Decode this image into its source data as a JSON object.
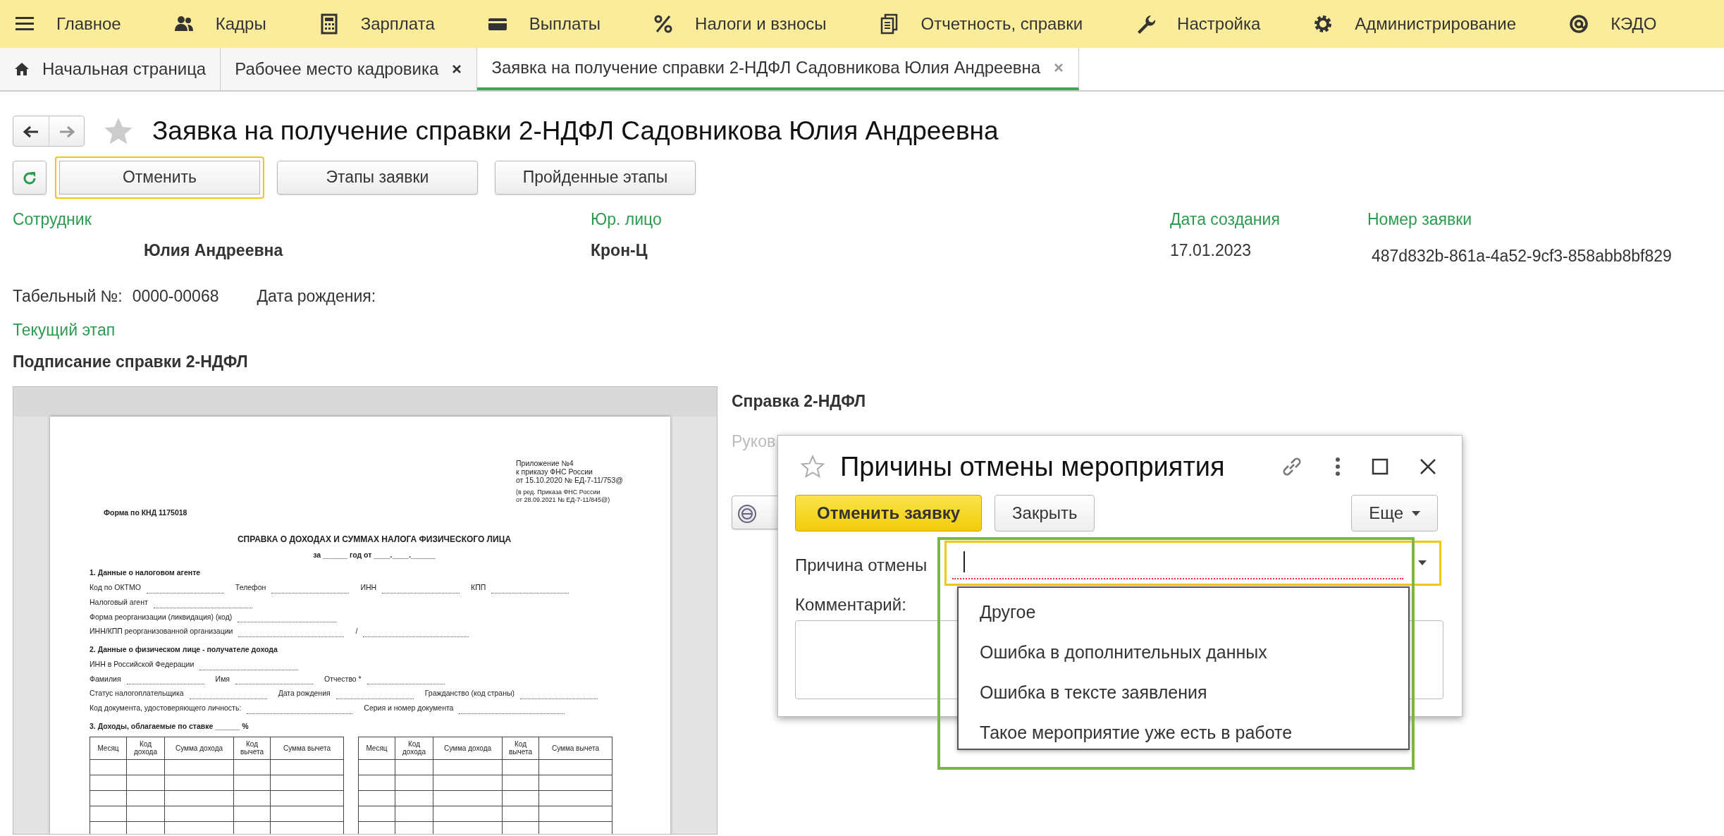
{
  "menu": [
    {
      "label": "Главное"
    },
    {
      "label": "Кадры"
    },
    {
      "label": "Зарплата"
    },
    {
      "label": "Выплаты"
    },
    {
      "label": "Налоги и взносы"
    },
    {
      "label": "Отчетность, справки"
    },
    {
      "label": "Настройка"
    },
    {
      "label": "Администрирование"
    },
    {
      "label": "КЭДО"
    }
  ],
  "tabs": [
    {
      "label": "Начальная страница",
      "selected": false,
      "closable": false,
      "home": true
    },
    {
      "label": "Рабочее место кадровика",
      "selected": false,
      "closable": true,
      "home": false
    },
    {
      "label": "Заявка на получение справки 2-НДФЛ Садовникова Юлия Андреевна",
      "selected": true,
      "closable": true,
      "home": false
    }
  ],
  "form": {
    "title": "Заявка на получение справки 2-НДФЛ Садовникова Юлия Андреевна",
    "favorite": false,
    "buttons": [
      {
        "label": "Отменить",
        "focused": true
      },
      {
        "label": "Этапы заявки",
        "focused": false
      },
      {
        "label": "Пройденные этапы",
        "focused": false
      }
    ],
    "fields": [
      {
        "label": "Сотрудник",
        "value": "Юлия Андреевна"
      },
      {
        "label": "Юр. лицо",
        "value": "Крон-Ц"
      },
      {
        "label": "Дата создания",
        "value": "17.01.2023"
      },
      {
        "label": "Номер заявки",
        "value": "487d832b-861a-4a52-9cf3-858abb8bf829"
      }
    ],
    "personnel_number": {
      "label": "Табельный №:",
      "value": "0000-00068"
    },
    "birth_date": {
      "label": "Дата рождения:"
    },
    "current_stage": {
      "label": "Текущий этап",
      "value": "Подписание справки 2-НДФЛ"
    },
    "side": {
      "title": "Справка 2-НДФЛ",
      "text": "Руков"
    }
  },
  "document": {
    "appendix": [
      "Приложение №4",
      "к приказу ФНС России",
      "от 15.10.2020 № ЕД-7-11/753@"
    ],
    "amendment": [
      "(в ред. Приказа ФНС России",
      "от 28.09.2021 № ЕД-7-11/845@)"
    ],
    "form_code": "Форма по КНД 1175018",
    "heading": "СПРАВКА О ДОХОДАХ И СУММАХ НАЛОГА ФИЗИЧЕСКОГО ЛИЦА",
    "period": "за ______ год от ____.____.______",
    "sections": [
      {
        "title": "1. Данные о налоговом агенте",
        "rows": [
          [
            "Код по ОКТМО",
            "Телефон",
            "ИНН",
            "КПП"
          ],
          [
            "Налоговый агент"
          ],
          [
            "Форма реорганизации (ликвидация) (код)"
          ],
          [
            "ИНН/КПП реорганизованной организации",
            "/"
          ]
        ]
      },
      {
        "title": "2. Данные о физическом лице - получателе дохода",
        "rows": [
          [
            "ИНН в Российской Федерации"
          ],
          [
            "Фамилия",
            "Имя",
            "Отчество *"
          ],
          [
            "Статус налогоплательщика",
            "Дата рождения",
            "Гражданство (код страны)"
          ],
          [
            "Код документа, удостоверяющего личность:",
            "Серия и номер документа"
          ]
        ]
      },
      {
        "title": "3. Доходы, облагаемые по ставке ______ %"
      }
    ],
    "tables": [
      {
        "columns": [
          "Месяц",
          "Код дохода",
          "Сумма дохода",
          "Код вычета",
          "Сумма вычета"
        ]
      },
      {
        "columns": [
          "Месяц",
          "Код дохода",
          "Сумма дохода",
          "Код вычета",
          "Сумма вычета"
        ]
      }
    ]
  },
  "dialog": {
    "title": "Причины отмены мероприятия",
    "favorite": false,
    "buttons": [
      {
        "label": "Отменить заявку",
        "default": true
      },
      {
        "label": "Закрыть",
        "default": false
      }
    ],
    "more": "Еще",
    "reason": {
      "label": "Причина отмены",
      "focused": true
    },
    "comment": {
      "label": "Комментарий:"
    },
    "options": [
      "Другое",
      "Ошибка в дополнительных данных",
      "Ошибка в тексте заявления",
      "Такое мероприятие уже есть в работе"
    ]
  }
}
